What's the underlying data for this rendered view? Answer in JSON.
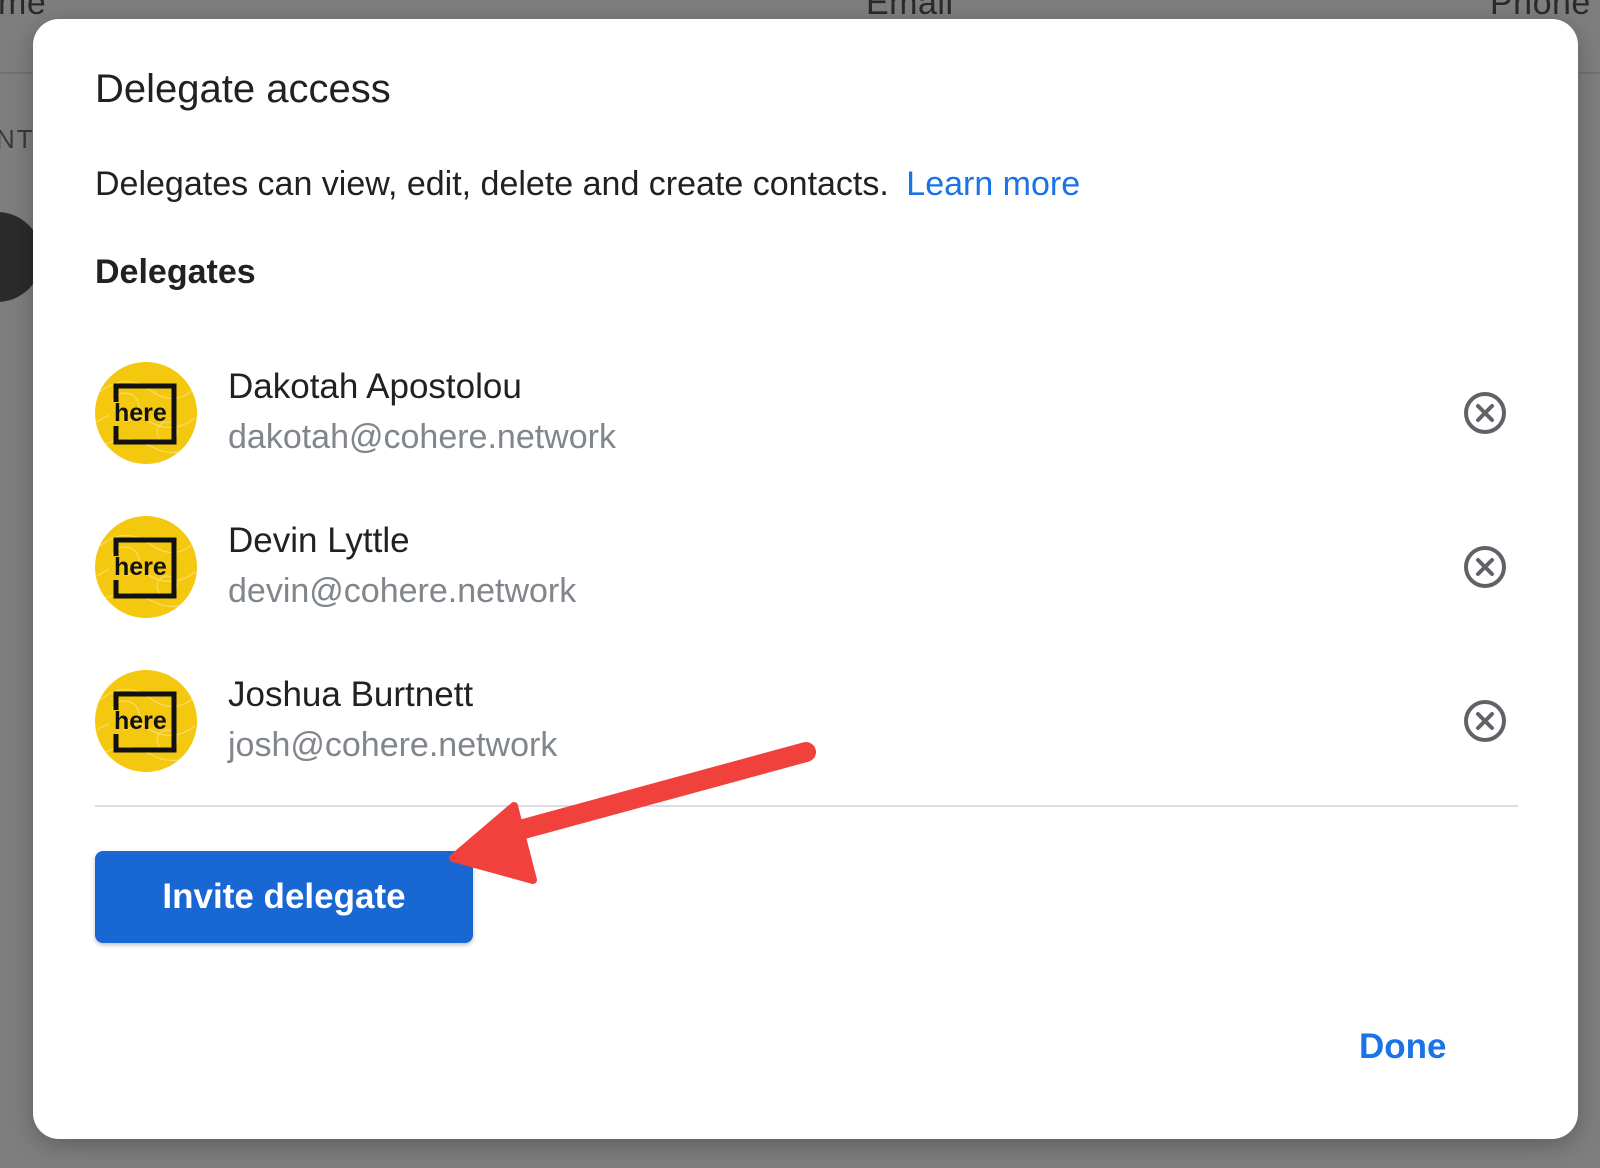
{
  "background": {
    "columns": {
      "name": "me",
      "email": "Email",
      "phone": "Phone"
    },
    "section_label": "NTA"
  },
  "dialog": {
    "title": "Delegate access",
    "description": "Delegates can view, edit, delete and create contacts.",
    "learn_more": "Learn more",
    "section_heading": "Delegates",
    "delegates": [
      {
        "name": "Dakotah Apostolou",
        "email": "dakotah@cohere.network",
        "avatar_text": "here"
      },
      {
        "name": "Devin Lyttle",
        "email": "devin@cohere.network",
        "avatar_text": "here"
      },
      {
        "name": "Joshua Burtnett",
        "email": "josh@cohere.network",
        "avatar_text": "here"
      }
    ],
    "remove_icon": "close-circle-icon",
    "invite_button": "Invite delegate",
    "done_button": "Done"
  },
  "colors": {
    "accent": "#1a73e8",
    "primary_button": "#1967d2",
    "avatar_yellow": "#f3c80f",
    "annotation_arrow": "#f0413c"
  }
}
